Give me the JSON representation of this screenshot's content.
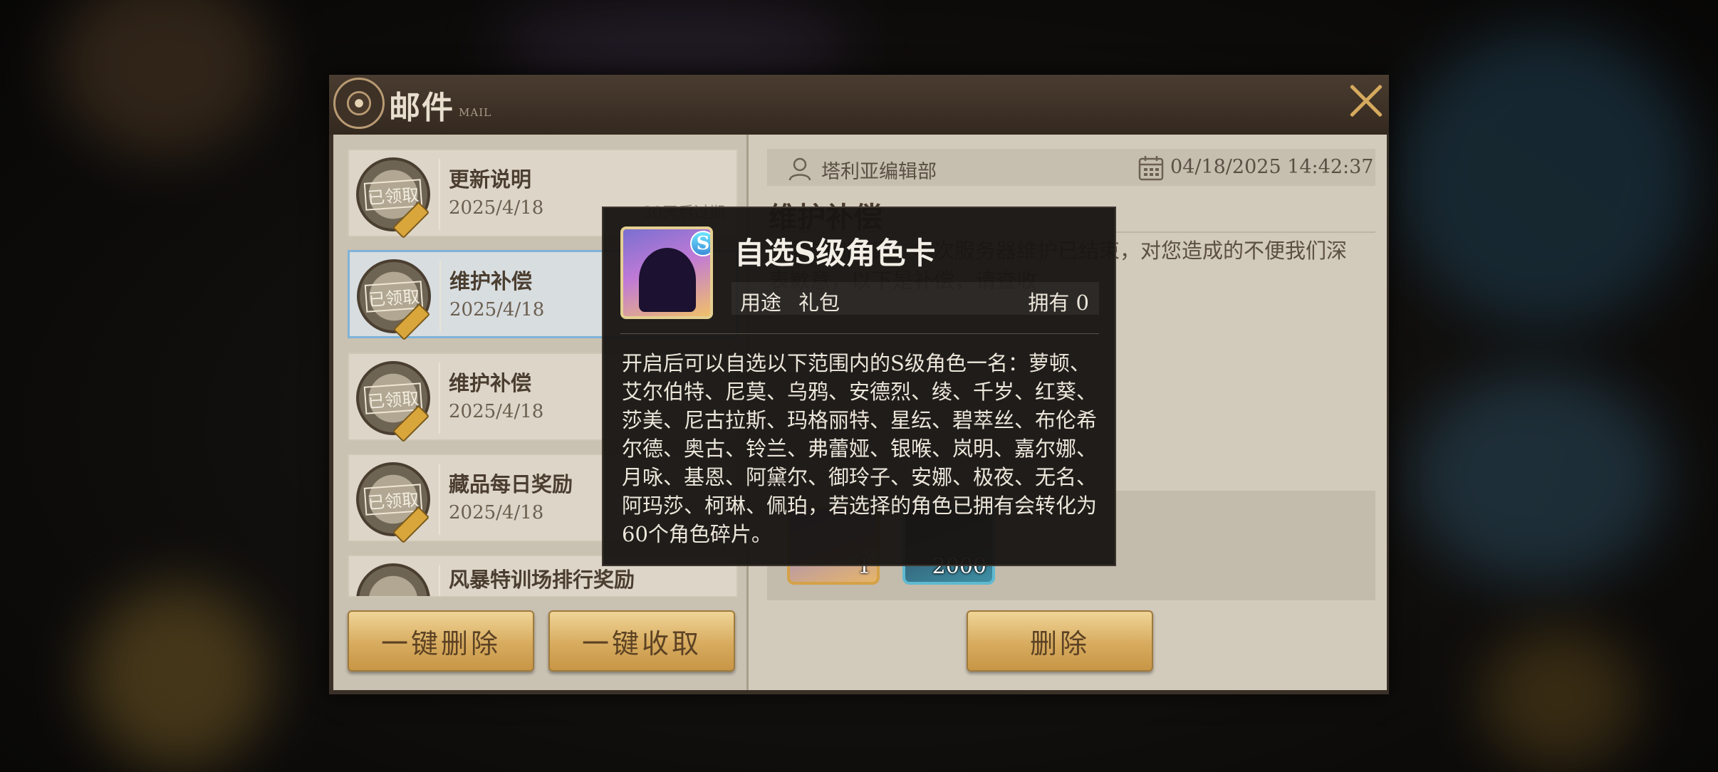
{
  "header": {
    "title": "邮件",
    "subtitle": "MAIL"
  },
  "mail_list": [
    {
      "title": "更新说明",
      "date": "2025/4/18",
      "expire": "30天后过期",
      "badge": "已领取",
      "selected": false
    },
    {
      "title": "维护补偿",
      "date": "2025/4/18",
      "badge": "已领取",
      "selected": true
    },
    {
      "title": "维护补偿",
      "date": "2025/4/18",
      "badge": "已领取",
      "selected": false
    },
    {
      "title": "藏品每日奖励",
      "date": "2025/4/18",
      "badge": "已领取",
      "selected": false
    },
    {
      "title": "风暴特训场排行奖励",
      "date": "",
      "badge": "",
      "selected": false
    }
  ],
  "actions": {
    "delete_all": "一键删除",
    "claim_all": "一键收取",
    "delete": "删除"
  },
  "detail": {
    "sender": "塔利亚编辑部",
    "datetime": "04/18/2025 14:42:37",
    "subject": "维护补偿",
    "body": "亲爱的训练家，本次服务器维护已结束，对您造成的不便我们深表歉意，以下是补偿，请查收",
    "attachments": [
      {
        "count": "1"
      },
      {
        "count": "2000"
      }
    ]
  },
  "tooltip": {
    "name": "自选S级角色卡",
    "badge": "S",
    "usage_label": "用途",
    "usage_value": "礼包",
    "owned": "拥有 0",
    "description": "开启后可以自选以下范围内的S级角色一名：萝顿、艾尔伯特、尼莫、乌鸦、安德烈、绫、千岁、红葵、莎美、尼古拉斯、玛格丽特、星纭、碧萃丝、布伦希尔德、奥古、铃兰、弗蕾娅、银喉、岚明、嘉尔娜、月咏、基恩、阿黛尔、御玲子、安娜、极夜、无名、阿玛莎、柯琳、佩珀，若选择的角色已拥有会转化为60个角色碎片。"
  },
  "colors": {
    "accent_gold": "#d7ab5f",
    "selected_border": "#7fb3d8",
    "tooltip_bg": "#181513"
  }
}
